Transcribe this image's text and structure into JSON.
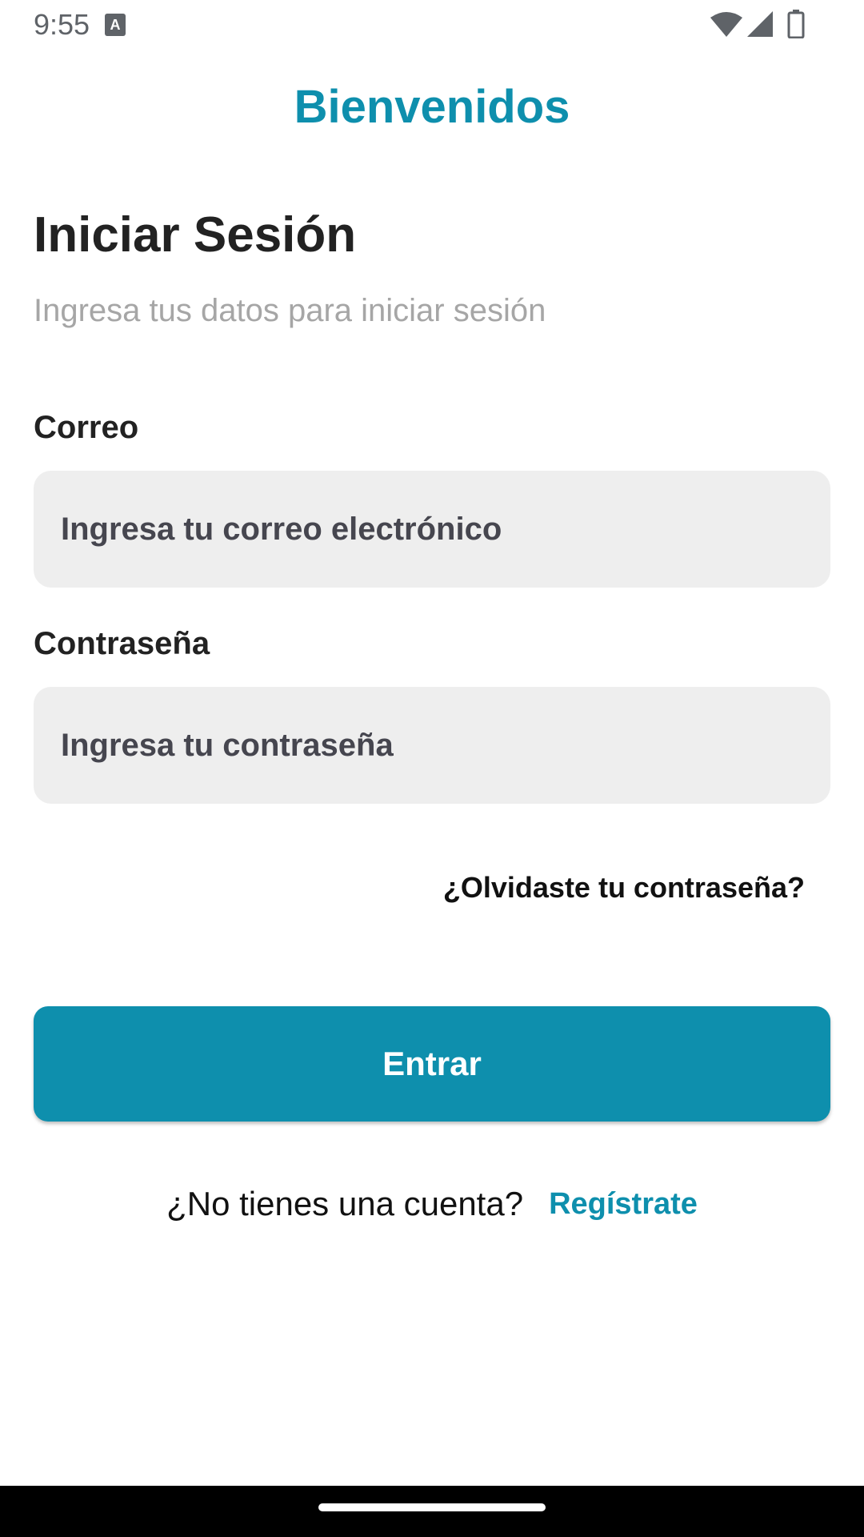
{
  "status_bar": {
    "time": "9:55",
    "a_badge": "A",
    "icons": [
      "a-notification-icon",
      "wifi-icon",
      "signal-icon",
      "battery-icon"
    ]
  },
  "app": {
    "title": "Bienvenidos",
    "accent_color": "#0e8fad"
  },
  "login": {
    "heading": "Iniciar Sesión",
    "subtitle": "Ingresa tus datos para iniciar sesión",
    "email": {
      "label": "Correo",
      "value": "",
      "placeholder": "Ingresa tu correo electrónico"
    },
    "password": {
      "label": "Contraseña",
      "value": "",
      "placeholder": "Ingresa tu contraseña"
    },
    "forgot_password": "¿Olvidaste tu contraseña?",
    "submit_label": "Entrar",
    "signup_prompt": "¿No tienes una cuenta?",
    "signup_link": "Regístrate"
  }
}
